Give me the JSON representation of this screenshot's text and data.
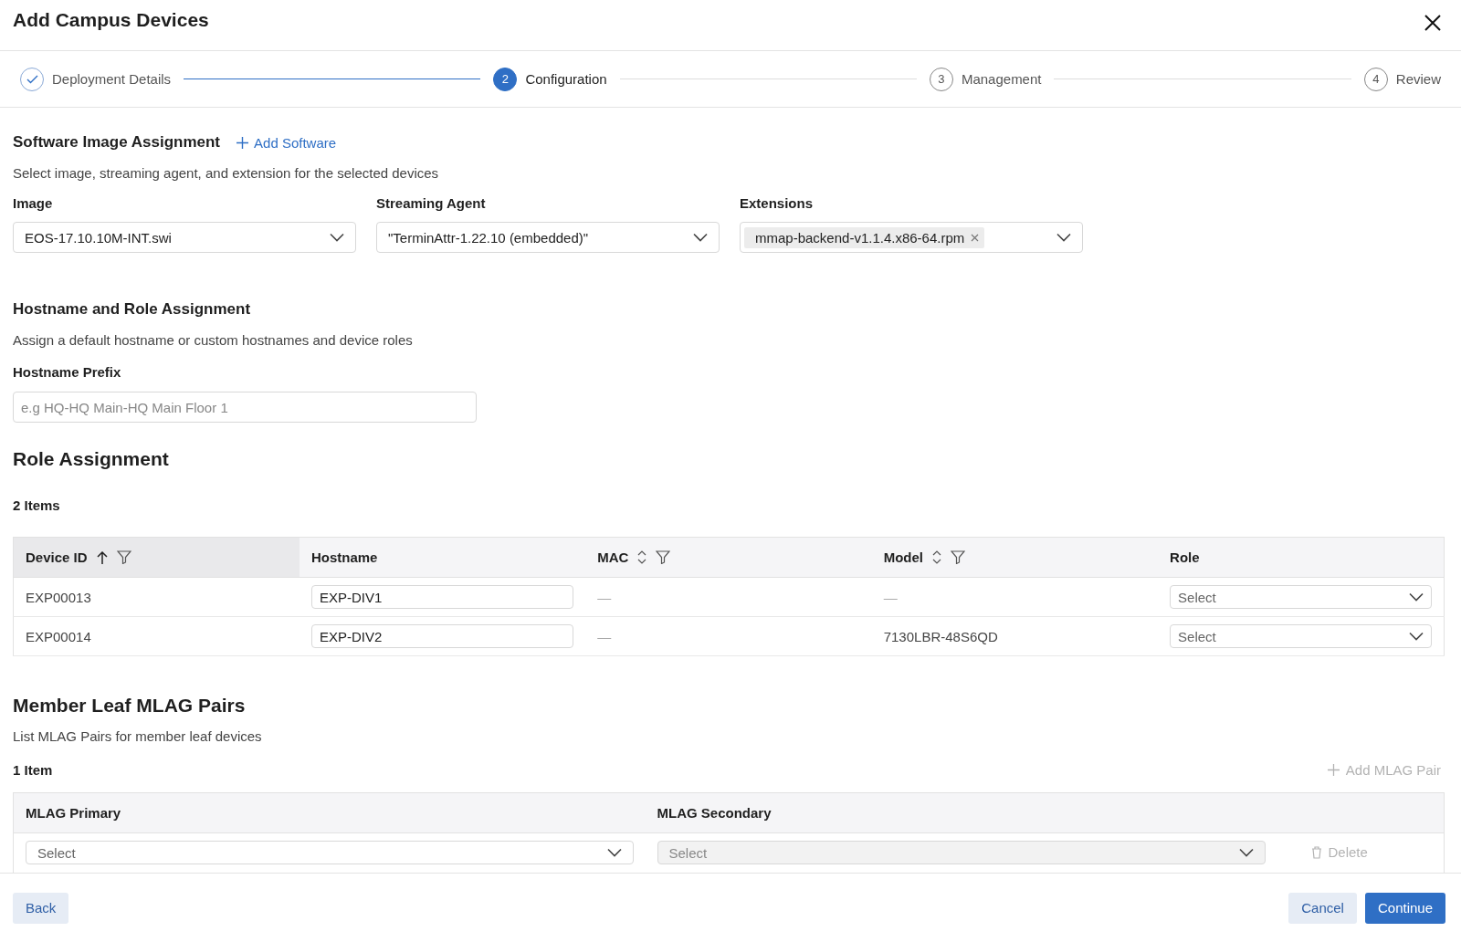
{
  "dialog": {
    "title": "Add Campus Devices"
  },
  "steps": [
    {
      "label": "Deployment Details",
      "completed": true,
      "current": false
    },
    {
      "number": "2",
      "label": "Configuration",
      "completed": false,
      "current": true
    },
    {
      "number": "3",
      "label": "Management",
      "completed": false,
      "current": false
    },
    {
      "number": "4",
      "label": "Review",
      "completed": false,
      "current": false
    }
  ],
  "software": {
    "title": "Software Image Assignment",
    "add_link": "Add Software",
    "description": "Select image, streaming agent, and extension for the selected devices",
    "fields": [
      {
        "kind": "select",
        "label": "Image",
        "value": "EOS-17.10.10M-INT.swi"
      },
      {
        "kind": "select",
        "label": "Streaming Agent",
        "value": "\"TerminAttr-1.22.10 (embedded)\""
      },
      {
        "kind": "multiselect",
        "label": "Extensions",
        "tags": [
          "mmap-backend-v1.1.4.x86-64.rpm"
        ]
      }
    ]
  },
  "hostname": {
    "title": "Hostname and Role Assignment",
    "description": "Assign a default hostname or custom hostnames and device roles",
    "prefix": {
      "label": "Hostname Prefix",
      "placeholder": "e.g HQ-HQ Main-HQ Main Floor 1"
    }
  },
  "role_assignment": {
    "title": "Role Assignment",
    "count": "2 Items",
    "columns": [
      {
        "label": "Device ID",
        "sorted_ascending": true,
        "sortable": true,
        "filterable": true
      },
      {
        "label": "Hostname",
        "sorted_ascending": false,
        "sortable": false,
        "filterable": false
      },
      {
        "label": "MAC",
        "sorted_ascending": false,
        "sortable": true,
        "filterable": true
      },
      {
        "label": "Model",
        "sorted_ascending": false,
        "sortable": true,
        "filterable": true
      },
      {
        "label": "Role",
        "sorted_ascending": false,
        "sortable": false,
        "filterable": false
      }
    ],
    "rows": [
      {
        "device_id": "EXP00013",
        "hostname": "EXP-DIV1",
        "mac": "—",
        "model": "—",
        "role": {
          "placeholder": "Select"
        }
      },
      {
        "device_id": "EXP00014",
        "hostname": "EXP-DIV2",
        "mac": "—",
        "model": "7130LBR-48S6QD",
        "role": {
          "placeholder": "Select"
        }
      }
    ]
  },
  "mlag": {
    "title": "Member Leaf MLAG Pairs",
    "description": "List MLAG Pairs for member leaf devices",
    "count": "1 Item",
    "add_button": {
      "label": "Add MLAG Pair",
      "disabled": true
    },
    "columns": [
      "MLAG Primary",
      "MLAG Secondary"
    ],
    "rows": [
      {
        "primary": {
          "placeholder": "Select",
          "disabled": false
        },
        "secondary": {
          "placeholder": "Select",
          "disabled": true
        },
        "delete": {
          "label": "Delete",
          "disabled": true
        }
      }
    ]
  },
  "footer": {
    "back": "Back",
    "cancel": "Cancel",
    "continue": "Continue"
  }
}
